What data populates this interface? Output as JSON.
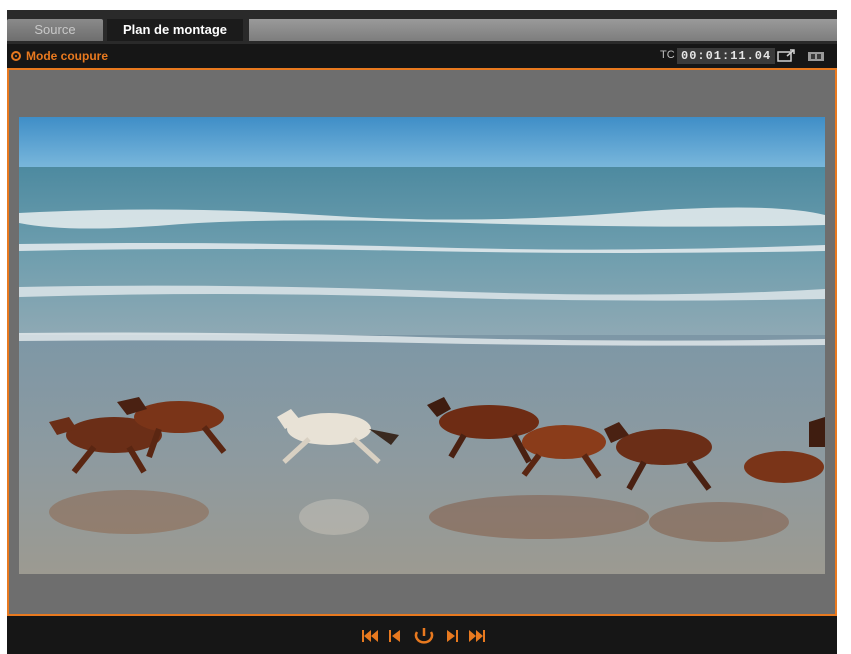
{
  "tabs": [
    {
      "label": "Source",
      "active": false
    },
    {
      "label": "Plan de montage",
      "active": true
    }
  ],
  "status": {
    "mode_label": "Mode coupure",
    "tc_label": "TC",
    "timecode": "00:01:11.04"
  },
  "icons": {
    "mode": "scissors-mode-icon",
    "export": "export-icon",
    "fullscreen": "fullscreen-icon",
    "controls": [
      "skip-to-start-icon",
      "step-back-icon",
      "loop-icon",
      "step-forward-icon",
      "skip-to-end-icon"
    ]
  },
  "colors": {
    "accent": "#e8791f",
    "panel": "#1b1b1b",
    "frame_bg": "#6e6e6e"
  }
}
